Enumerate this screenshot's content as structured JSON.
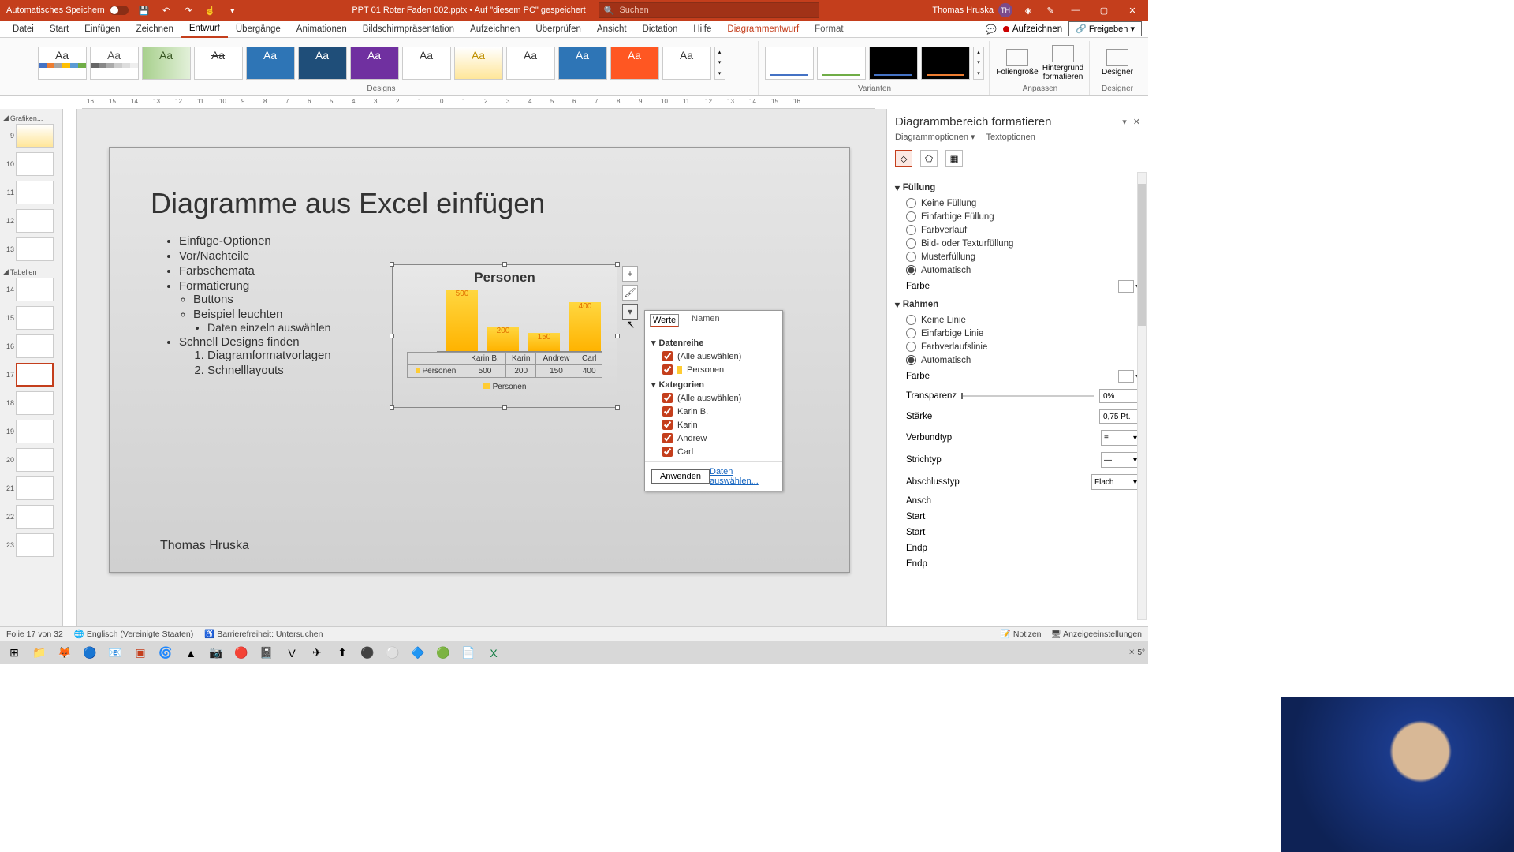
{
  "titlebar": {
    "autosave": "Automatisches Speichern",
    "doc": "PPT 01 Roter Faden 002.pptx • Auf \"diesem PC\" gespeichert",
    "search_placeholder": "Suchen",
    "user": "Thomas Hruska",
    "user_initials": "TH"
  },
  "tabs": [
    "Datei",
    "Start",
    "Einfügen",
    "Zeichnen",
    "Entwurf",
    "Übergänge",
    "Animationen",
    "Bildschirmpräsentation",
    "Aufzeichnen",
    "Überprüfen",
    "Ansicht",
    "Dictation",
    "Hilfe",
    "Diagrammentwurf",
    "Format"
  ],
  "tabs_active": "Entwurf",
  "ribbon_right": {
    "record": "Aufzeichnen",
    "share": "Freigeben"
  },
  "ribbon": {
    "designs_label": "Designs",
    "variants_label": "Varianten",
    "slide_size": "Foliengröße",
    "bg_format": "Hintergrund formatieren",
    "designer": "Designer",
    "customize_label": "Anpassen",
    "designer_label": "Designer"
  },
  "ruler_ticks": [
    "16",
    "15",
    "14",
    "13",
    "12",
    "11",
    "10",
    "9",
    "8",
    "7",
    "6",
    "5",
    "4",
    "3",
    "2",
    "1",
    "0",
    "1",
    "2",
    "3",
    "4",
    "5",
    "6",
    "7",
    "8",
    "9",
    "10",
    "11",
    "12",
    "13",
    "14",
    "15",
    "16"
  ],
  "slides": {
    "section1": "Grafiken...",
    "section2": "Tabellen",
    "numbers": [
      9,
      10,
      11,
      12,
      13,
      14,
      15,
      16,
      17,
      18,
      19,
      20,
      21,
      22,
      23
    ],
    "active": 17
  },
  "slide": {
    "title": "Diagramme aus Excel einfügen",
    "b1": "Einfüge-Optionen",
    "b2": "Vor/Nachteile",
    "b3": "Farbschemata",
    "b4": "Formatierung",
    "b4a": "Buttons",
    "b4b": "Beispiel leuchten",
    "b4b1": "Daten einzeln auswählen",
    "b5": "Schnell Designs finden",
    "b5_1": "Diagramformatvorlagen",
    "b5_2": "Schnelllayouts",
    "author": "Thomas Hruska"
  },
  "chart": {
    "title": "Personen",
    "legend": "Personen",
    "row_label": "Personen"
  },
  "chart_data": {
    "type": "bar",
    "title": "Personen",
    "categories": [
      "Karin B.",
      "Karin",
      "Andrew",
      "Carl"
    ],
    "series": [
      {
        "name": "Personen",
        "values": [
          500,
          200,
          150,
          400
        ]
      }
    ],
    "ylim": [
      0,
      500
    ]
  },
  "filter": {
    "tab_values": "Werte",
    "tab_names": "Namen",
    "group_series": "Datenreihe",
    "group_categories": "Kategorien",
    "select_all": "(Alle auswählen)",
    "series_items": [
      "Personen"
    ],
    "cat_items": [
      "Karin B.",
      "Karin",
      "Andrew",
      "Carl"
    ],
    "apply": "Anwenden",
    "select_data": "Daten auswählen..."
  },
  "format_pane": {
    "title": "Diagrammbereich formatieren",
    "tab_chart": "Diagrammoptionen",
    "tab_text": "Textoptionen",
    "sec_fill": "Füllung",
    "fill_opts": [
      "Keine Füllung",
      "Einfarbige Füllung",
      "Farbverlauf",
      "Bild- oder Texturfüllung",
      "Musterfüllung",
      "Automatisch"
    ],
    "fill_selected": "Automatisch",
    "color_label": "Farbe",
    "sec_border": "Rahmen",
    "border_opts": [
      "Keine Linie",
      "Einfarbige Linie",
      "Farbverlaufslinie",
      "Automatisch"
    ],
    "border_selected": "Automatisch",
    "transp_label": "Transparenz",
    "transp_val": "0%",
    "width_label": "Stärke",
    "width_val": "0,75 Pt.",
    "compound_label": "Verbundtyp",
    "dash_label": "Strichtyp",
    "cap_label": "Abschlusstyp",
    "cap_val": "Flach",
    "join_label": "Ansch",
    "arrow_start_type": "Start",
    "arrow_start_size": "Start",
    "arrow_end_type": "Endp",
    "arrow_end_size": "Endp"
  },
  "status": {
    "slide_of": "Folie 17 von 32",
    "lang": "Englisch (Vereinigte Staaten)",
    "a11y": "Barrierefreiheit: Untersuchen",
    "notes": "Notizen",
    "display": "Anzeigeeinstellungen"
  },
  "taskbar": {
    "temp": "5°"
  }
}
